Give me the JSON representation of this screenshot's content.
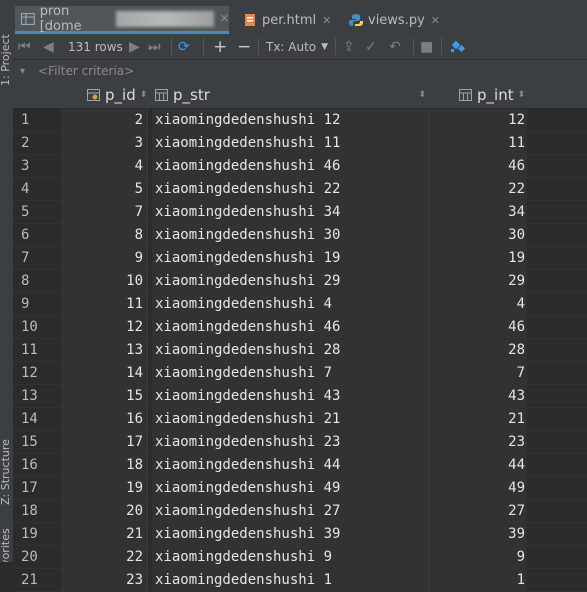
{
  "side_tools": {
    "project": "1: Project",
    "structure": "Z: Structure",
    "favorites": "Favorites"
  },
  "tabs": [
    {
      "label": "pron [dome",
      "active": true,
      "icon": "table-icon"
    },
    {
      "label": "per.html",
      "active": false,
      "icon": "html-file-icon"
    },
    {
      "label": "views.py",
      "active": false,
      "icon": "python-file-icon"
    }
  ],
  "toolbar": {
    "rows_count": "131 rows",
    "tx_mode": "Tx: Auto"
  },
  "filter": {
    "placeholder": "<Filter criteria>"
  },
  "columns": [
    {
      "label": "p_id"
    },
    {
      "label": "p_str"
    },
    {
      "label": "p_int"
    }
  ],
  "rows": [
    {
      "n": "1",
      "p_id": "2",
      "p_str": "xiaomingdedenshushi 12",
      "p_int": "12"
    },
    {
      "n": "2",
      "p_id": "3",
      "p_str": "xiaomingdedenshushi 11",
      "p_int": "11"
    },
    {
      "n": "3",
      "p_id": "4",
      "p_str": "xiaomingdedenshushi 46",
      "p_int": "46"
    },
    {
      "n": "4",
      "p_id": "5",
      "p_str": "xiaomingdedenshushi 22",
      "p_int": "22"
    },
    {
      "n": "5",
      "p_id": "7",
      "p_str": "xiaomingdedenshushi 34",
      "p_int": "34"
    },
    {
      "n": "6",
      "p_id": "8",
      "p_str": "xiaomingdedenshushi 30",
      "p_int": "30"
    },
    {
      "n": "7",
      "p_id": "9",
      "p_str": "xiaomingdedenshushi 19",
      "p_int": "19"
    },
    {
      "n": "8",
      "p_id": "10",
      "p_str": "xiaomingdedenshushi 29",
      "p_int": "29"
    },
    {
      "n": "9",
      "p_id": "11",
      "p_str": "xiaomingdedenshushi 4",
      "p_int": "4"
    },
    {
      "n": "10",
      "p_id": "12",
      "p_str": "xiaomingdedenshushi 46",
      "p_int": "46"
    },
    {
      "n": "11",
      "p_id": "13",
      "p_str": "xiaomingdedenshushi 28",
      "p_int": "28"
    },
    {
      "n": "12",
      "p_id": "14",
      "p_str": "xiaomingdedenshushi 7",
      "p_int": "7"
    },
    {
      "n": "13",
      "p_id": "15",
      "p_str": "xiaomingdedenshushi 43",
      "p_int": "43"
    },
    {
      "n": "14",
      "p_id": "16",
      "p_str": "xiaomingdedenshushi 21",
      "p_int": "21"
    },
    {
      "n": "15",
      "p_id": "17",
      "p_str": "xiaomingdedenshushi 23",
      "p_int": "23"
    },
    {
      "n": "16",
      "p_id": "18",
      "p_str": "xiaomingdedenshushi 44",
      "p_int": "44"
    },
    {
      "n": "17",
      "p_id": "19",
      "p_str": "xiaomingdedenshushi 49",
      "p_int": "49"
    },
    {
      "n": "18",
      "p_id": "20",
      "p_str": "xiaomingdedenshushi 27",
      "p_int": "27"
    },
    {
      "n": "19",
      "p_id": "21",
      "p_str": "xiaomingdedenshushi 39",
      "p_int": "39"
    },
    {
      "n": "20",
      "p_id": "22",
      "p_str": "xiaomingdedenshushi 9",
      "p_int": "9"
    },
    {
      "n": "21",
      "p_id": "23",
      "p_str": "xiaomingdedenshushi 1",
      "p_int": "1"
    }
  ],
  "colors": {
    "accent": "#4a88c7",
    "tx_icon": "#3d9be9"
  }
}
